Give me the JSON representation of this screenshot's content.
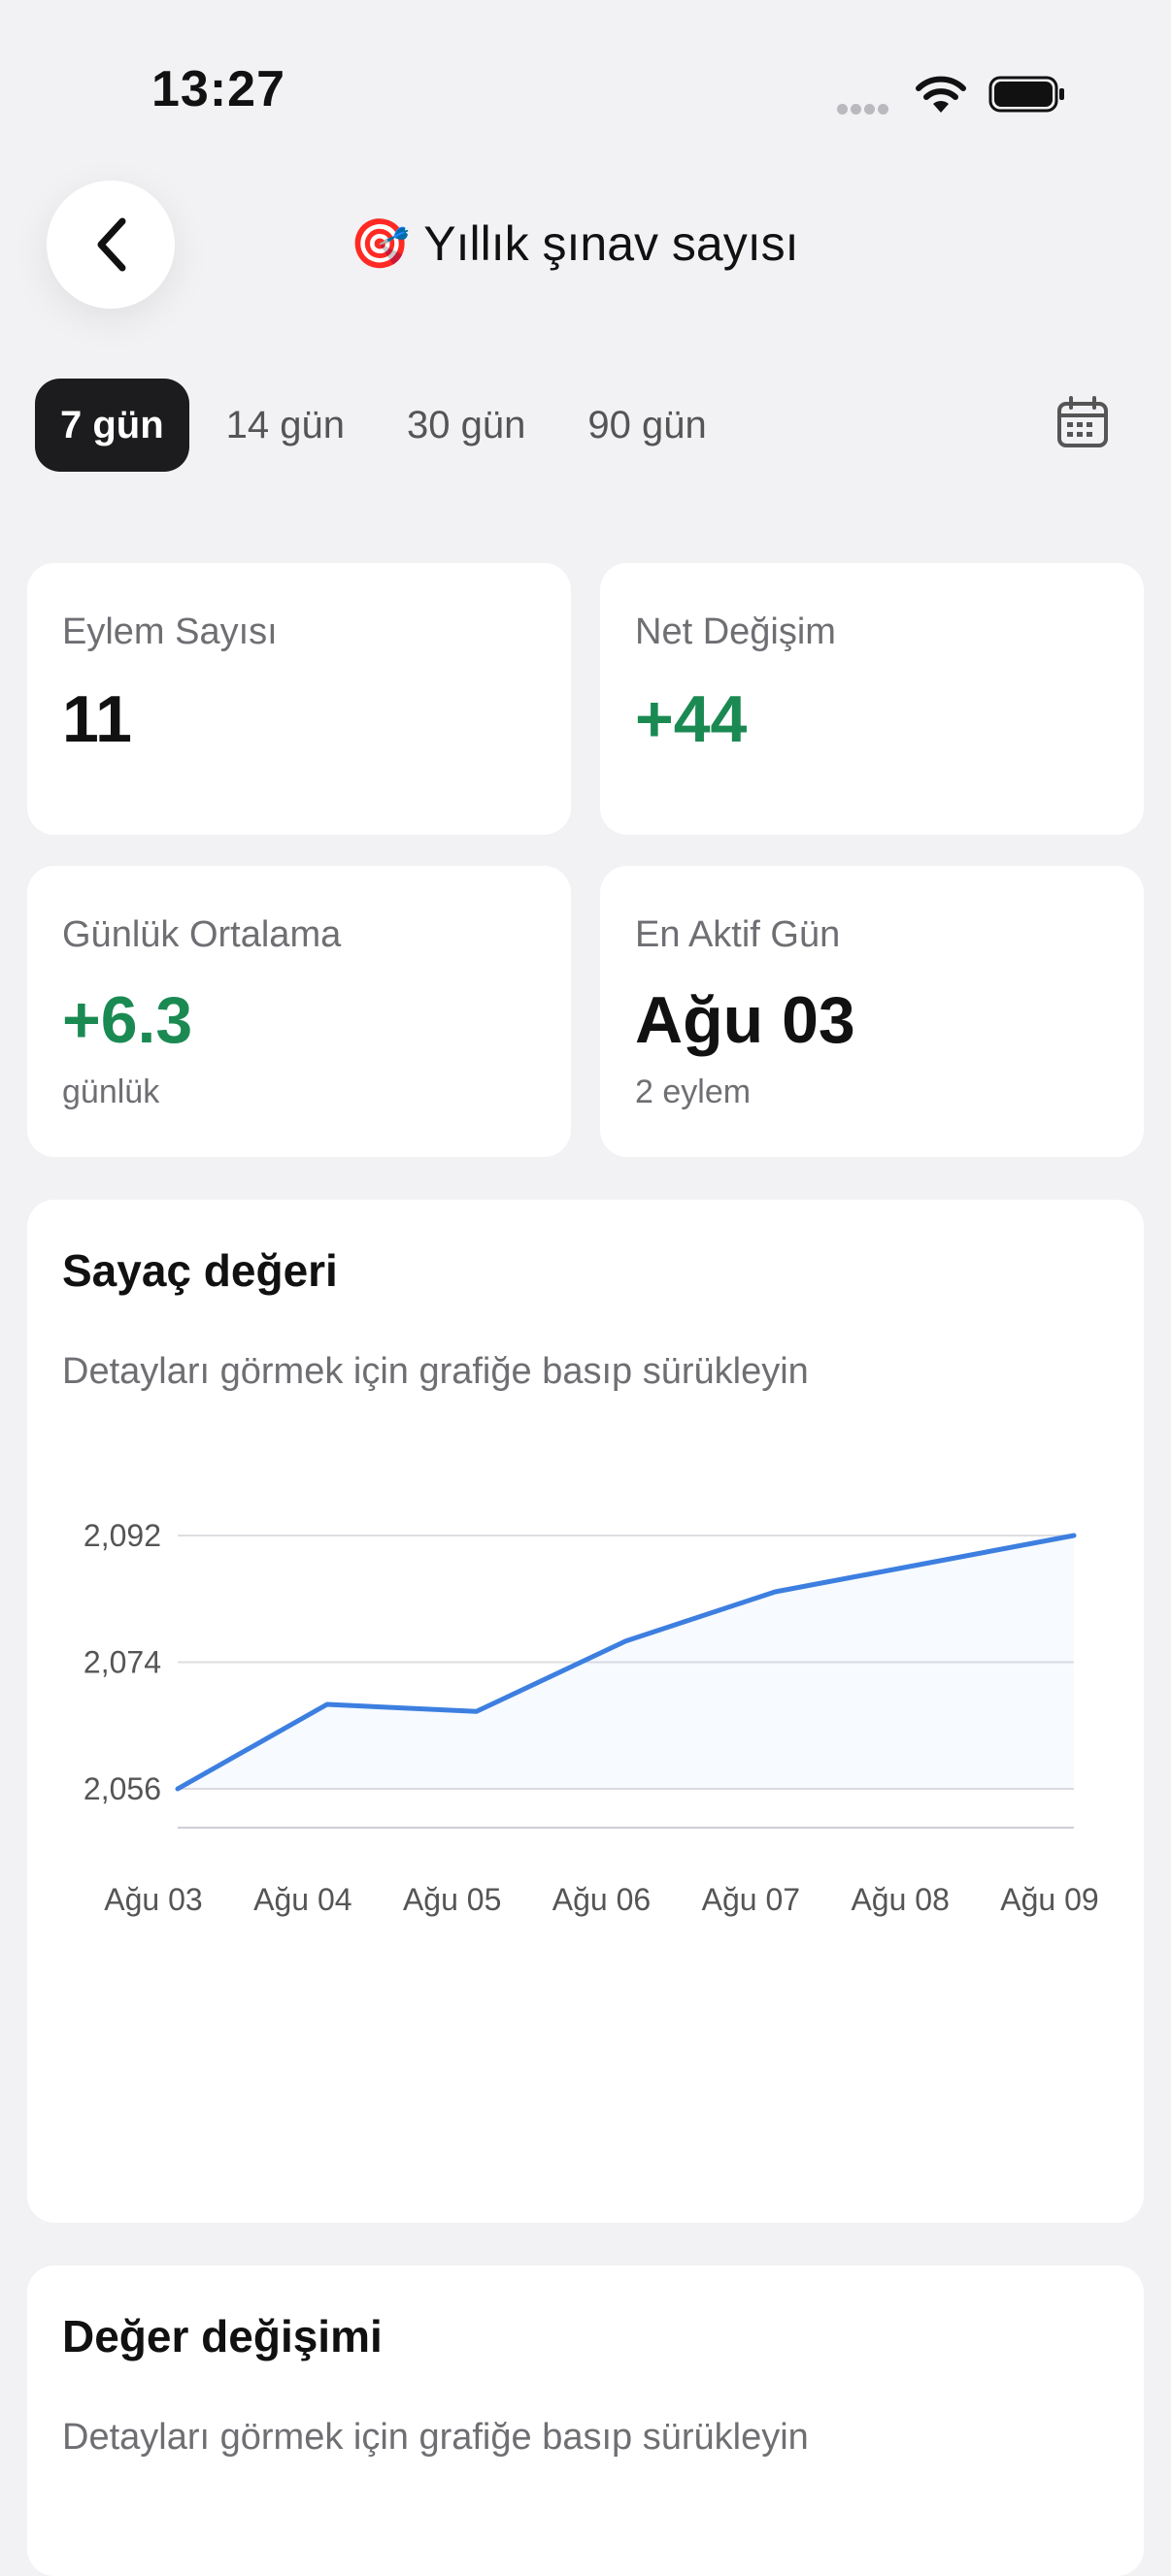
{
  "status": {
    "time": "13:27"
  },
  "header": {
    "title": "Yıllık şınav sayısı",
    "emoji": "🎯"
  },
  "ranges": [
    {
      "label": "7 gün",
      "active": true
    },
    {
      "label": "14 gün",
      "active": false
    },
    {
      "label": "30 gün",
      "active": false
    },
    {
      "label": "90 gün",
      "active": false
    }
  ],
  "stats": {
    "actions": {
      "label": "Eylem Sayısı",
      "value": "11"
    },
    "net_change": {
      "label": "Net Değişim",
      "value": "+44"
    },
    "daily_avg": {
      "label": "Günlük Ortalama",
      "value": "+6.3",
      "sub": "günlük"
    },
    "most_active": {
      "label": "En Aktif Gün",
      "value": "Ağu 03",
      "sub": "2 eylem"
    }
  },
  "counter_chart": {
    "title": "Sayaç değeri",
    "hint": "Detayları görmek için grafiğe basıp sürükleyin"
  },
  "change_chart": {
    "title": "Değer değişimi",
    "hint": "Detayları görmek için grafiğe basıp sürükleyin"
  },
  "colors": {
    "accent": "#3d7fe0",
    "positive": "#1a8a52",
    "active_tab": "#1c1c1e"
  },
  "chart_data": {
    "type": "line",
    "title": "Sayaç değeri",
    "categories": [
      "Ağu 03",
      "Ağu 04",
      "Ağu 05",
      "Ağu 06",
      "Ağu 07",
      "Ağu 08",
      "Ağu 09"
    ],
    "x": [
      "Ağu 03",
      "Ağu 04",
      "Ağu 05",
      "Ağu 06",
      "Ağu 07",
      "Ağu 08",
      "Ağu 09"
    ],
    "values": [
      2056,
      2068,
      2067,
      2077,
      2084,
      2088,
      2092
    ],
    "y_ticks": [
      "2,056",
      "2,074",
      "2,092"
    ],
    "ylim": [
      2056,
      2092
    ],
    "grid": true,
    "xlabel": "",
    "ylabel": ""
  }
}
